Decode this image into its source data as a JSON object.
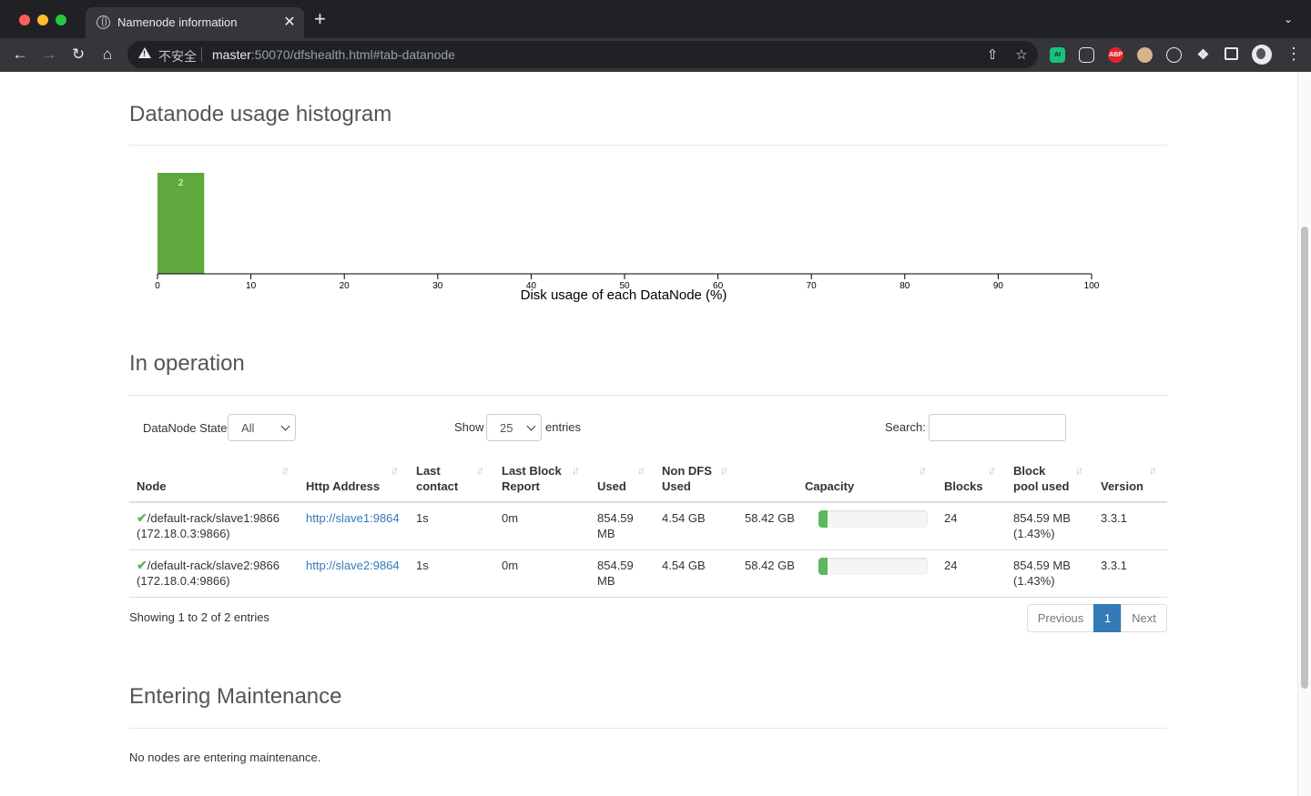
{
  "browser": {
    "tab_title": "Namenode information",
    "tab_close": "✕",
    "new_tab": "+",
    "security_label": "不安全",
    "url_host": "master",
    "url_rest": ":50070/dfshealth.html#tab-datanode",
    "extensions": [
      "AI",
      "ABP"
    ]
  },
  "sections": {
    "histogram_title": "Datanode usage histogram",
    "in_operation_title": "In operation",
    "maintenance_title": "Entering Maintenance",
    "maintenance_text": "No nodes are entering maintenance."
  },
  "chart_data": {
    "type": "bar",
    "xlabel": "Disk usage of each DataNode (%)",
    "xlim": [
      0,
      100
    ],
    "xticks": [
      0,
      10,
      20,
      30,
      40,
      50,
      60,
      70,
      80,
      90,
      100
    ],
    "bins": [
      {
        "x0": 0,
        "x1": 5,
        "count": 2
      }
    ],
    "color": "#5fa83d"
  },
  "controls": {
    "state_label": "DataNode State",
    "state_value": "All",
    "show_label": "Show",
    "show_value": "25",
    "entries_label": "entries",
    "search_label": "Search:"
  },
  "table": {
    "columns": [
      {
        "line1": "",
        "line2": "Node"
      },
      {
        "line1": "",
        "line2": "Http Address"
      },
      {
        "line1": "Last",
        "line2": "contact"
      },
      {
        "line1": "Last Block",
        "line2": "Report"
      },
      {
        "line1": "",
        "line2": "Used"
      },
      {
        "line1": "Non DFS",
        "line2": "Used"
      },
      {
        "line1": "",
        "line2": "Capacity"
      },
      {
        "line1": "",
        "line2": "Blocks"
      },
      {
        "line1": "Block",
        "line2": "pool used"
      },
      {
        "line1": "",
        "line2": "Version"
      }
    ],
    "rows": [
      {
        "node_line1": "/default-rack/slave1:9866",
        "node_line2": "(172.18.0.3:9866)",
        "http": "http://slave1:9864",
        "last_contact": "1s",
        "last_block": "0m",
        "used_line1": "854.59",
        "used_line2": "MB",
        "non_dfs": "4.54 GB",
        "capacity": "58.42 GB",
        "usage_fraction": 0.08,
        "blocks": "24",
        "pool_line1": "854.59 MB",
        "pool_line2": "(1.43%)",
        "version": "3.3.1"
      },
      {
        "node_line1": "/default-rack/slave2:9866",
        "node_line2": "(172.18.0.4:9866)",
        "http": "http://slave2:9864",
        "last_contact": "1s",
        "last_block": "0m",
        "used_line1": "854.59",
        "used_line2": "MB",
        "non_dfs": "4.54 GB",
        "capacity": "58.42 GB",
        "usage_fraction": 0.08,
        "blocks": "24",
        "pool_line1": "854.59 MB",
        "pool_line2": "(1.43%)",
        "version": "3.3.1"
      }
    ],
    "info": "Showing 1 to 2 of 2 entries"
  },
  "pagination": {
    "previous": "Previous",
    "current": "1",
    "next": "Next"
  },
  "colors": {
    "chrome": "#202124",
    "link": "#337ab7",
    "success": "#5cb85c"
  }
}
